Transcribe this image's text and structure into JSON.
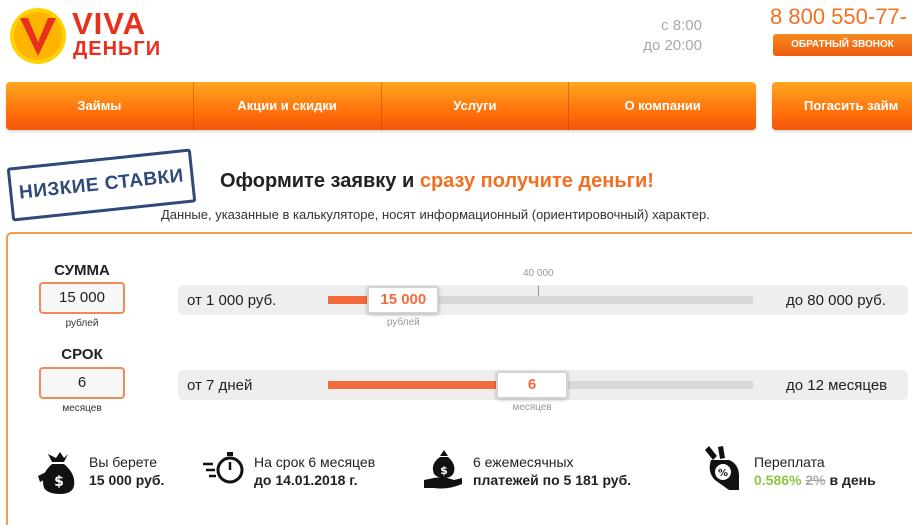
{
  "header": {
    "brand_line1": "VIVA",
    "brand_line2": "ДЕНЬГИ",
    "hours_from": "с 8:00",
    "hours_to": "до 20:00",
    "phone": "8 800 550-77-",
    "callback_label": "ОБРАТНЫЙ ЗВОНОК"
  },
  "nav": {
    "items": [
      "Займы",
      "Акции и скидки",
      "Услуги",
      "О компании"
    ],
    "pay_label": "Погасить займ"
  },
  "promo": {
    "stamp": "НИЗКИЕ СТАВКИ",
    "headline_part1": "Оформите заявку и ",
    "headline_accent": "сразу получите деньги!",
    "disclaimer": "Данные, указанные в калькуляторе, носят информационный (ориентировочный) характер."
  },
  "calculator": {
    "amount": {
      "label": "СУММА",
      "value": "15 000",
      "unit": "рублей",
      "range_from": "от 1 000 руб.",
      "range_to": "до 80 000 руб.",
      "min": 1000,
      "max": 80000,
      "current": 15000,
      "tick_label": "40 000",
      "tick_value": 40000
    },
    "term": {
      "label": "СРОК",
      "value": "6",
      "unit": "месяцев",
      "range_from": "от 7 дней",
      "range_to": "до 12 месяцев",
      "fill_fraction": 0.48
    }
  },
  "summary": {
    "take_label": "Вы берете",
    "take_value": "15 000 руб.",
    "term_label": "На срок 6 месяцев",
    "term_value": "до 14.01.2018 г.",
    "payments_label": "6 ежемесячных",
    "payments_value": "платежей по 5 181 руб.",
    "overpay_label": "Переплата",
    "overpay_rate": "0.586%",
    "overpay_old": "2%",
    "overpay_suffix": "в день"
  },
  "colors": {
    "accent": "#f37021",
    "brand_red": "#e8301c",
    "stamp_blue": "#2f4a7a",
    "green": "#8cc63f"
  }
}
